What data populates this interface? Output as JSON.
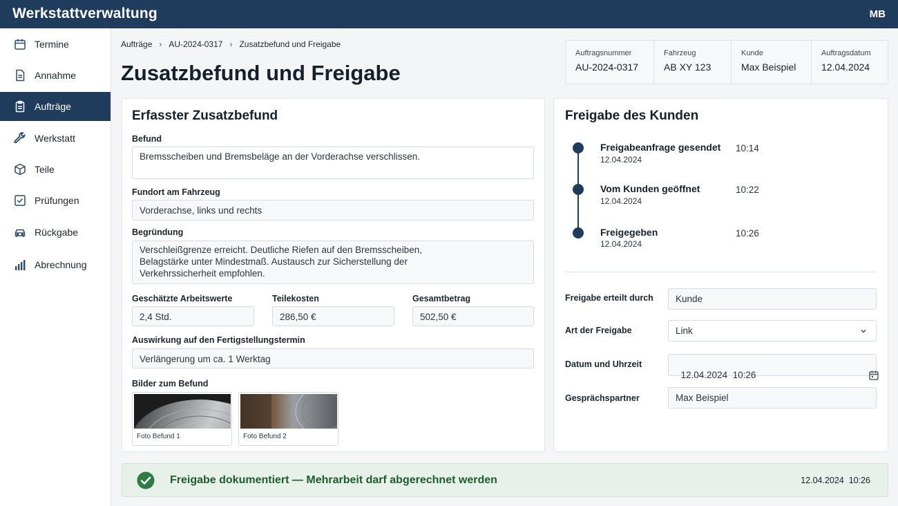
{
  "app": {
    "title": "Werkstattverwaltung",
    "user_initials": "MB"
  },
  "sidebar": {
    "items": [
      {
        "label": "Termine",
        "icon": "calendar-icon"
      },
      {
        "label": "Annahme",
        "icon": "document-icon"
      },
      {
        "label": "Aufträge",
        "icon": "clipboard-icon",
        "active": true
      },
      {
        "label": "Werkstatt",
        "icon": "wrench-icon"
      },
      {
        "label": "Teile",
        "icon": "box-icon"
      },
      {
        "label": "Prüfungen",
        "icon": "checkbox-icon"
      },
      {
        "label": "Rückgabe",
        "icon": "car-icon"
      },
      {
        "label": "Abrechnung",
        "icon": "bar-chart-icon"
      }
    ]
  },
  "breadcrumb": [
    "Aufträge",
    "AU-2024-0317",
    "Zusatzbefund und Freigabe"
  ],
  "page": {
    "title": "Zusatzbefund und Freigabe"
  },
  "order_info": [
    {
      "label": "Auftragsnummer",
      "value": "AU-2024-0317"
    },
    {
      "label": "Fahrzeug",
      "value": "AB XY 123"
    },
    {
      "label": "Kunde",
      "value": "Max Beispiel"
    },
    {
      "label": "Auftragsdatum",
      "value": "12.04.2024"
    }
  ],
  "finding": {
    "title": "Erfasster Zusatzbefund",
    "befund_label": "Befund",
    "befund_value": "Bremsscheiben und Bremsbeläge an der Vorderachse verschlissen.",
    "fundort_label": "Fundort am Fahrzeug",
    "fundort_value": "Vorderachse, links und rechts",
    "begruendung_label": "Begründung",
    "begruendung_lines": [
      "Verschleißgrenze erreicht. Deutliche Riefen auf den Bremsscheiben,",
      "Belagstärke unter Mindestmaß. Austausch zur Sicherstellung der",
      "Verkehrssicherheit empfohlen."
    ],
    "arbeitswerte_label": "Geschätzte Arbeitswerte",
    "arbeitswerte_value": "2,4 Std.",
    "teilekosten_label": "Teilekosten",
    "teilekosten_value": "286,50 €",
    "gesamt_label": "Gesamtbetrag",
    "gesamt_value": "502,50 €",
    "auswirkung_label": "Auswirkung auf den Fertigstellungstermin",
    "auswirkung_value": "Verlängerung um ca. 1 Werktag",
    "bilder_label": "Bilder zum Befund",
    "photos": [
      {
        "caption": "Foto Befund 1"
      },
      {
        "caption": "Foto Befund 2"
      }
    ]
  },
  "approval": {
    "title": "Freigabe des Kunden",
    "timeline": [
      {
        "title": "Freigabeanfrage gesendet",
        "date": "12.04.2024",
        "time": "10:14"
      },
      {
        "title": "Vom Kunden geöffnet",
        "date": "12.04.2024",
        "time": "10:22"
      },
      {
        "title": "Freigegeben",
        "date": "12.04.2024",
        "time": "10:26"
      }
    ],
    "form": {
      "erteilt_label": "Freigabe erteilt durch",
      "erteilt_value": "Kunde",
      "art_label": "Art der Freigabe",
      "art_value": "Link",
      "datum_label": "Datum und Uhrzeit",
      "datum_value": "12.04.2024  10:26",
      "partner_label": "Gesprächspartner",
      "partner_value": "Max Beispiel"
    }
  },
  "banner": {
    "text": "Freigabe dokumentiert — Mehrarbeit darf abgerechnet werden",
    "timestamp": "12.04.2024  10:26",
    "color": "#2e7d45"
  },
  "colors": {
    "brand": "#1f3c5c",
    "success": "#2e7d45"
  }
}
